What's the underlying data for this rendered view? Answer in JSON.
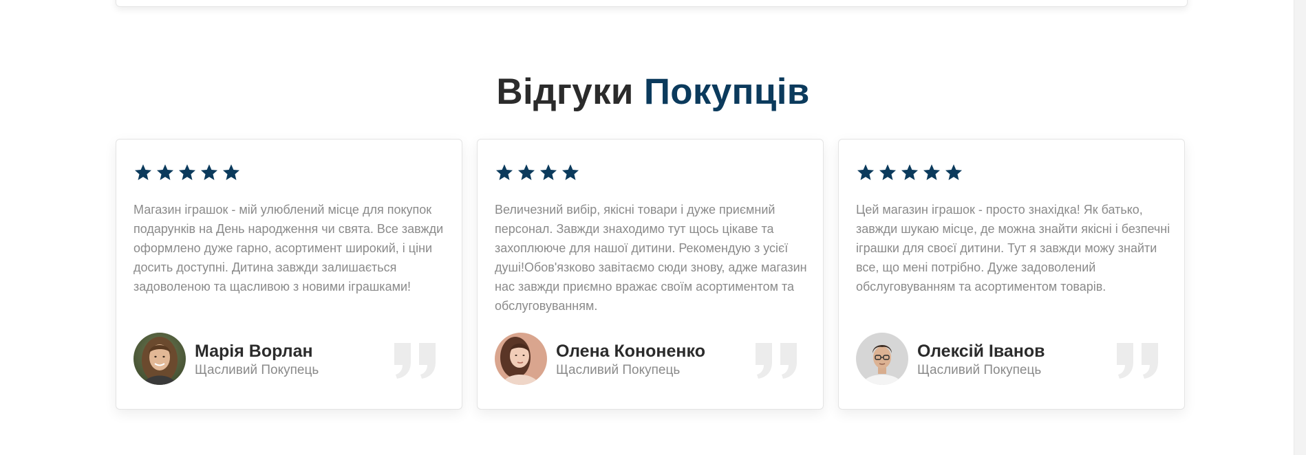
{
  "section": {
    "title_main": "Відгуки",
    "title_accent": "Покупців"
  },
  "colors": {
    "accent": "#0b3a5c",
    "heading": "#2b2b2b",
    "body_text": "#8a8a8a",
    "quote": "#ececec"
  },
  "reviews": [
    {
      "rating": 5,
      "text": "Магазин іграшок - мій улюблений місце для покупок подарунків на День народження чи свята. Все завжди оформлено дуже гарно, асортимент широкий, і ціни досить доступні. Дитина завжди залишається задоволеною та щасливою з новими іграшками!",
      "name": "Марія Ворлан",
      "role": "Щасливий Покупець",
      "avatar_icon": "avatar-photo-woman-icon",
      "quote_icon": "quote-icon"
    },
    {
      "rating": 4,
      "text": "Величезний вибір, якісні товари і дуже приємний персонал. Завжди знаходимо тут щось цікаве та захоплююче для нашої дитини. Рекомендую з усієї душі!Обов'язково завітаємо сюди знову, адже магазин нас завжди приємно вражає своїм асортиментом та обслуговуванням.",
      "name": "Олена Кононенко",
      "role": "Щасливий Покупець",
      "avatar_icon": "avatar-photo-woman-icon",
      "quote_icon": "quote-icon"
    },
    {
      "rating": 5,
      "text": "Цей магазин іграшок - просто знахідка! Як батько, завжди шукаю місце, де можна знайти якісні і безпечні іграшки для своєї дитини. Тут я завжди можу знайти все, що мені потрібно. Дуже задоволений обслуговуванням та асортиментом товарів.",
      "name": "Олексій Іванов",
      "role": "Щасливий Покупець",
      "avatar_icon": "avatar-photo-man-icon",
      "quote_icon": "quote-icon"
    }
  ]
}
